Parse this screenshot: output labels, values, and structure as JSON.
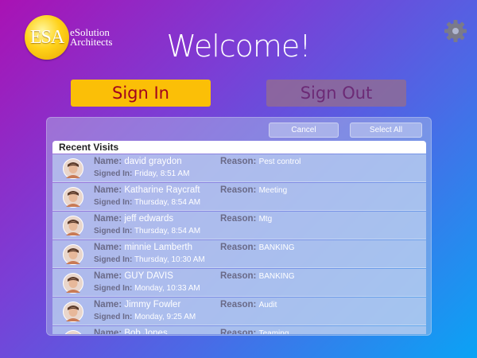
{
  "logo": {
    "abbrev": "ESA",
    "name_line1": "eSolution",
    "name_line2": "Architects"
  },
  "header": {
    "title": "Welcome!"
  },
  "actions": {
    "sign_in": "Sign In",
    "sign_out": "Sign Out"
  },
  "panel": {
    "cancel": "Cancel",
    "select_all": "Select All",
    "title": "Recent Visits",
    "labels": {
      "name": "Name:",
      "signed_in": "Signed In:",
      "reason": "Reason:"
    },
    "visits": [
      {
        "name": "david graydon",
        "signed_in": "Friday, 8:51 AM",
        "reason": "Pest control"
      },
      {
        "name": "Katharine Raycraft",
        "signed_in": "Thursday, 8:54 AM",
        "reason": "Meeting"
      },
      {
        "name": "jeff edwards",
        "signed_in": "Thursday, 8:54 AM",
        "reason": "Mtg"
      },
      {
        "name": "minnie Lamberth",
        "signed_in": "Thursday, 10:30 AM",
        "reason": "BANKING"
      },
      {
        "name": "GUY DAVIS",
        "signed_in": "Monday, 10:33 AM",
        "reason": "BANKING"
      },
      {
        "name": "Jimmy Fowler",
        "signed_in": "Monday, 9:25 AM",
        "reason": "Audit"
      },
      {
        "name": "Bob Jones",
        "signed_in": "",
        "reason": "Teaming"
      }
    ]
  },
  "colors": {
    "sign_in_bg": "#fbbf07",
    "sign_in_text": "#a0041f",
    "sign_out_text": "#6c2a76"
  },
  "icons": {
    "settings": "gear-icon",
    "avatar": "person-avatar-icon"
  }
}
